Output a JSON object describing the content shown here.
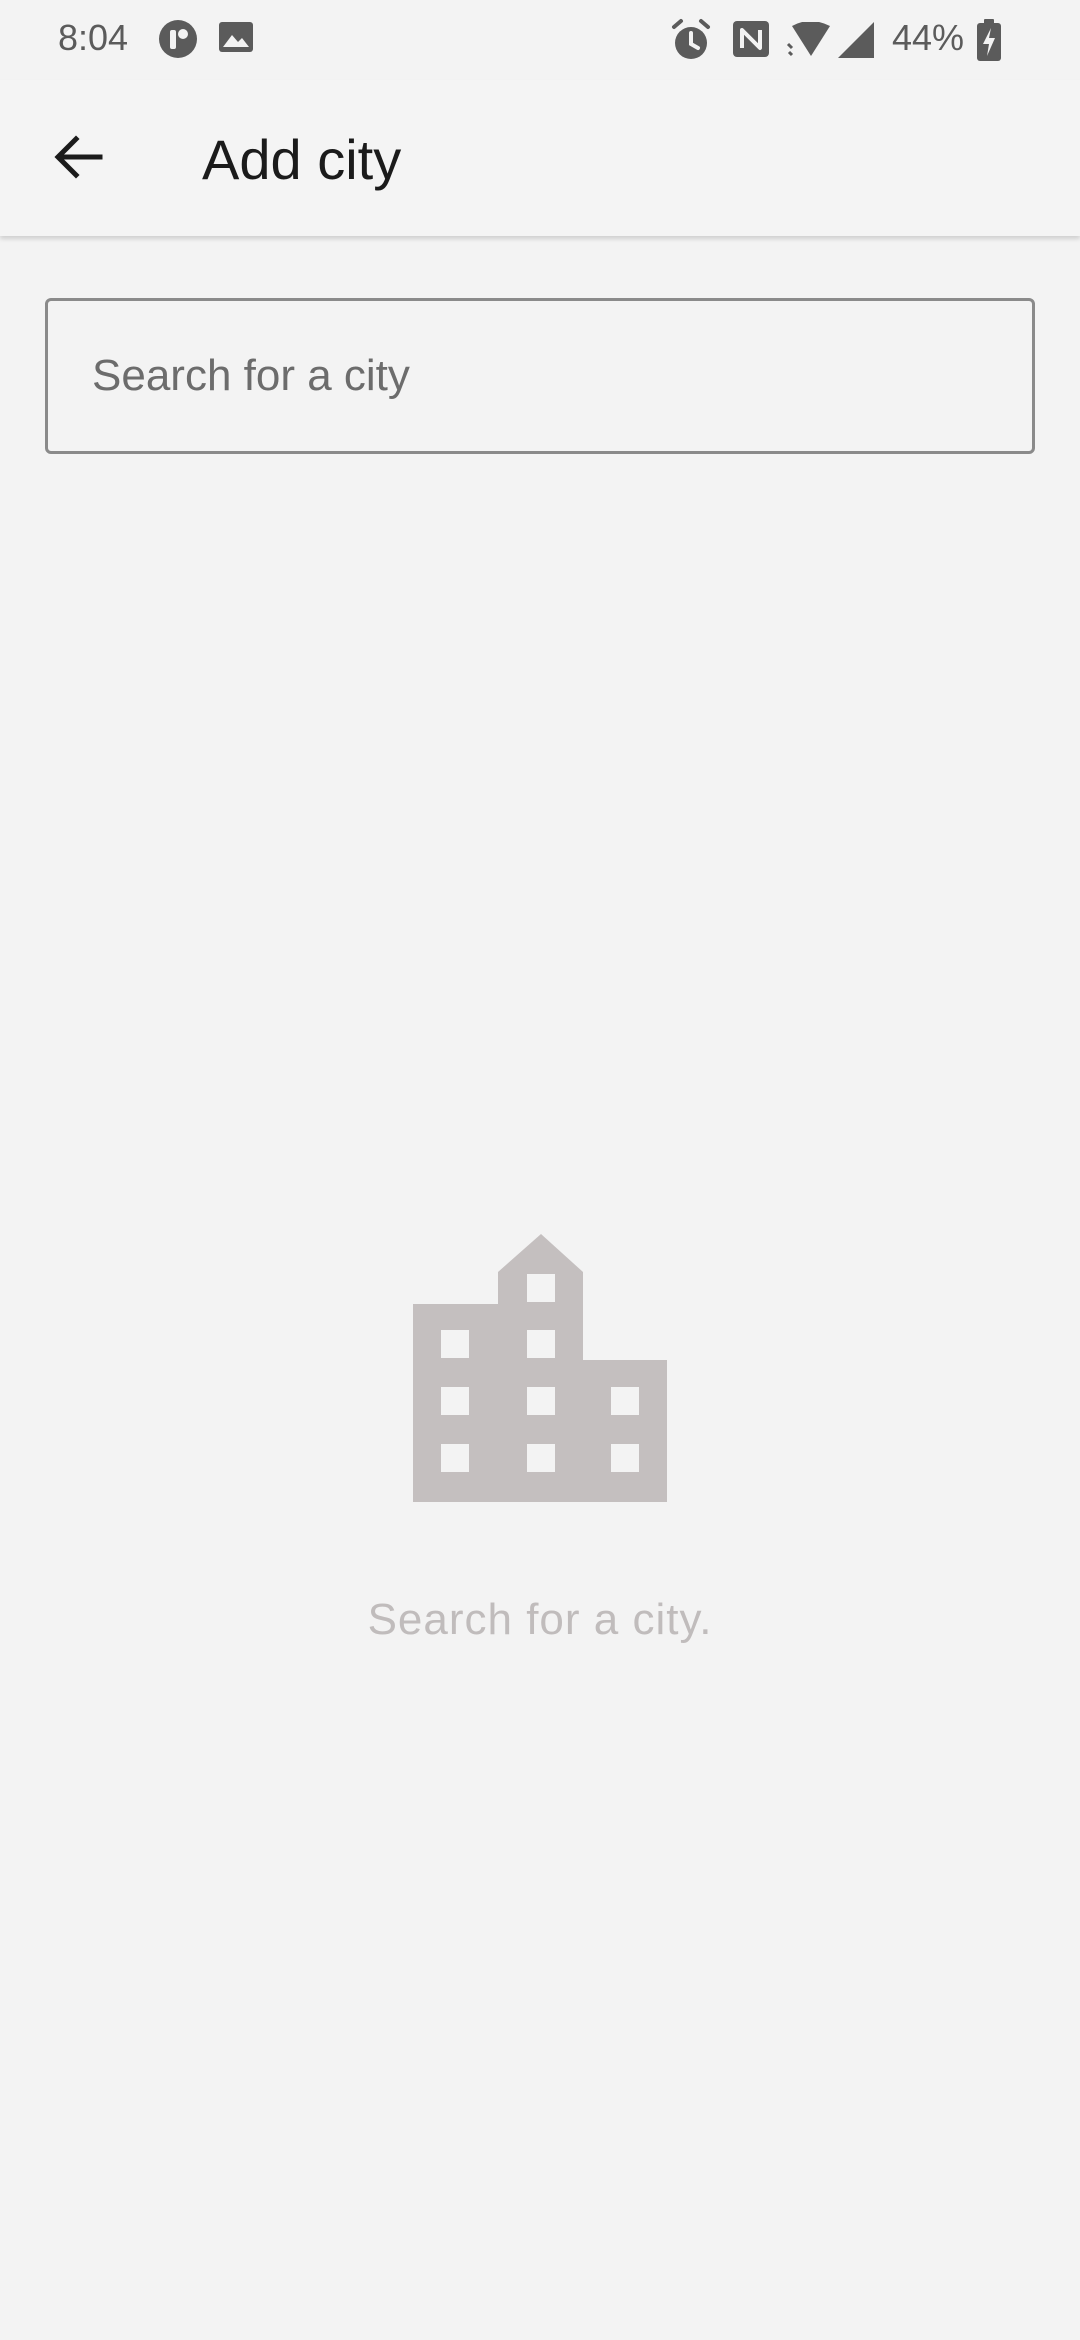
{
  "status_bar": {
    "time": "8:04",
    "battery_percent": "44%",
    "left_icons": [
      "app-notification-icon",
      "image-icon"
    ],
    "right_icons": [
      "alarm-icon",
      "nfc-icon",
      "wifi-icon",
      "cellular-signal-icon",
      "battery-charging-icon"
    ]
  },
  "app_bar": {
    "back_icon": "arrow-left-icon",
    "title": "Add city"
  },
  "search": {
    "placeholder": "Search for a city",
    "value": ""
  },
  "empty_state": {
    "icon": "city-buildings-icon",
    "message": "Search for a city."
  },
  "colors": {
    "background": "#f3f3f3",
    "title_text": "#1b1b1b",
    "field_border": "#8a8a8a",
    "illustration": "#c4bfbf",
    "empty_text": "#c0bcbc",
    "status_icons": "#5b5b5b"
  }
}
